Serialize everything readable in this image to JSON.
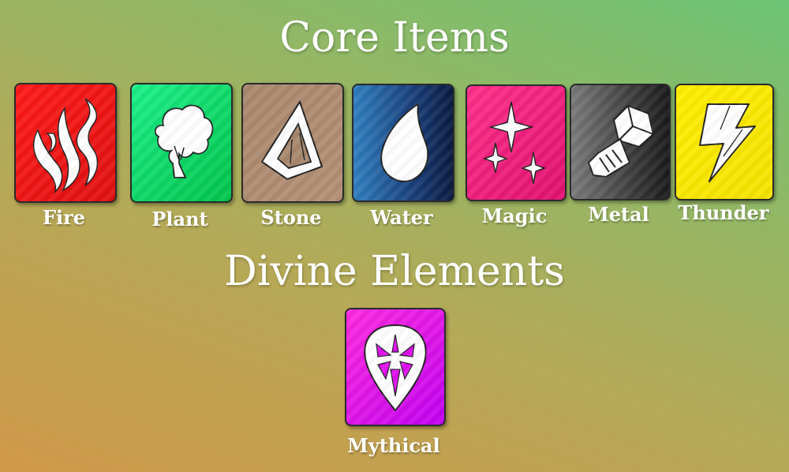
{
  "headings": {
    "core": "Core Items",
    "divine": "Divine Elements"
  },
  "core_items": [
    {
      "label": "Fire",
      "icon": "flame-icon",
      "color": "#ff1a1a"
    },
    {
      "label": "Plant",
      "icon": "tree-icon",
      "color": "#00d45a"
    },
    {
      "label": "Stone",
      "icon": "stone-icon",
      "color": "#a8886e"
    },
    {
      "label": "Water",
      "icon": "water-drop-icon",
      "color": "#1a3f7a"
    },
    {
      "label": "Magic",
      "icon": "sparkles-icon",
      "color": "#ff2f8a"
    },
    {
      "label": "Metal",
      "icon": "bolt-icon",
      "color": "#555555"
    },
    {
      "label": "Thunder",
      "icon": "lightning-icon",
      "color": "#ffef00"
    }
  ],
  "divine_elements": [
    {
      "label": "Mythical",
      "icon": "crystal-icon",
      "color": "#e010f0"
    }
  ]
}
